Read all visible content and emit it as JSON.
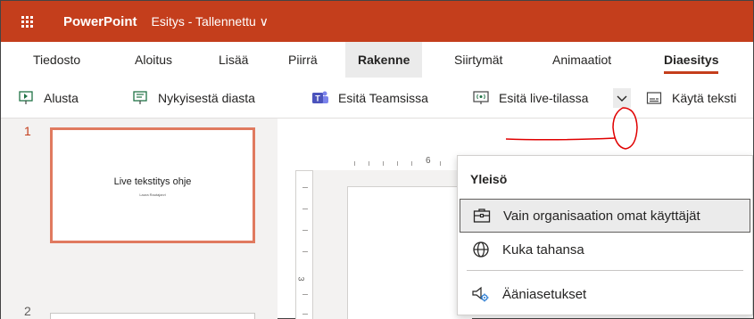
{
  "titlebar": {
    "app_name": "PowerPoint",
    "doc_title": "Esitys - Tallennettu ∨"
  },
  "tabs": [
    {
      "label": "Tiedosto"
    },
    {
      "label": "Aloitus"
    },
    {
      "label": "Lisää"
    },
    {
      "label": "Piirrä"
    },
    {
      "label": "Rakenne"
    },
    {
      "label": "Siirtymät"
    },
    {
      "label": "Animaatiot"
    },
    {
      "label": "Diaesitys"
    }
  ],
  "toolbar": {
    "from_start": "Alusta",
    "from_current": "Nykyisestä diasta",
    "present_teams": "Esitä Teamsissa",
    "present_live": "Esitä live-tilassa",
    "use_subtitles": "Käytä teksti"
  },
  "slides": {
    "n1": "1",
    "n2": "2",
    "thumb_title": "Live tekstitys ohje",
    "thumb_subtitle": "Laura Rautajarvi"
  },
  "ruler": {
    "h_num": "6",
    "v_num": "3"
  },
  "dropdown": {
    "header": "Yleisö",
    "items": [
      {
        "label": "Vain organisaation omat käyttäjät",
        "icon": "briefcase-icon"
      },
      {
        "label": "Kuka tahansa",
        "icon": "globe-icon"
      },
      {
        "label": "Ääniasetukset",
        "icon": "audio-settings-icon"
      }
    ]
  },
  "colors": {
    "brand": "#c43e1c",
    "annotation": "#e00000"
  }
}
